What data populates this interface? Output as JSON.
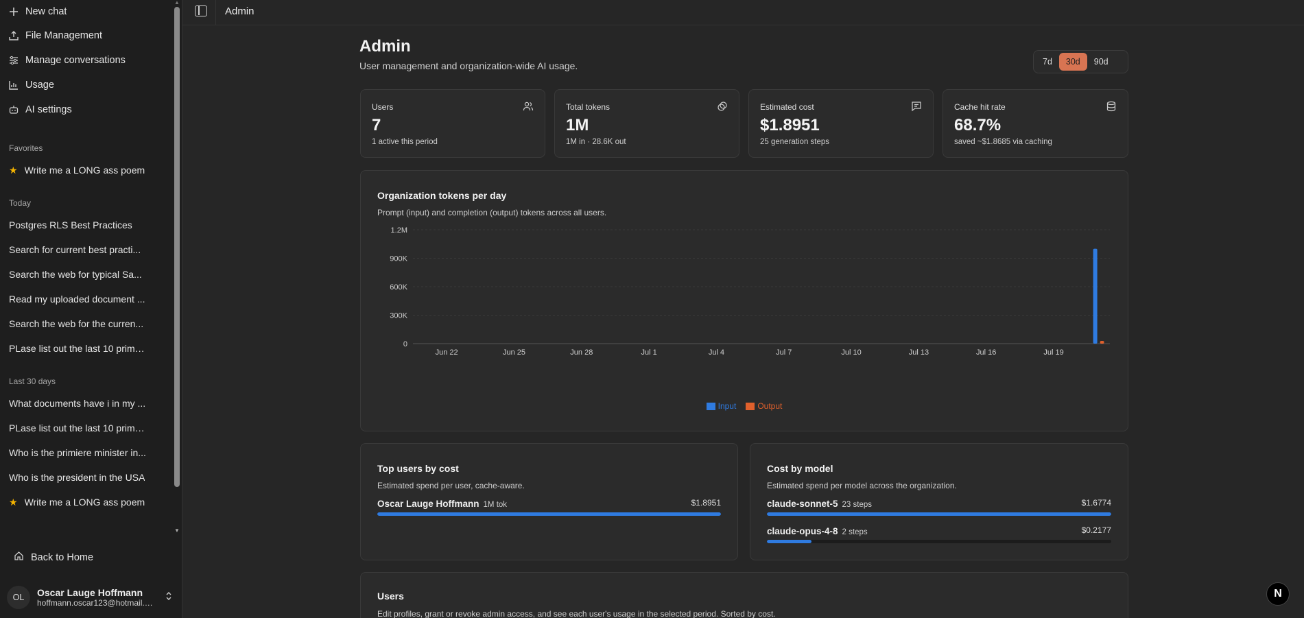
{
  "sidebar": {
    "actions": [
      {
        "label": "New chat",
        "icon": "plus-icon"
      },
      {
        "label": "File Management",
        "icon": "upload-icon"
      },
      {
        "label": "Manage conversations",
        "icon": "sliders-icon"
      },
      {
        "label": "Usage",
        "icon": "bar-chart-icon"
      },
      {
        "label": "AI settings",
        "icon": "bot-icon"
      }
    ],
    "favorites_heading": "Favorites",
    "favorites": [
      {
        "label": "Write me a LONG ass poem"
      }
    ],
    "today_heading": "Today",
    "today": [
      {
        "label": "Postgres RLS Best Practices"
      },
      {
        "label": "Search for current best practi..."
      },
      {
        "label": "Search the web for typical Sa..."
      },
      {
        "label": "Read my uploaded document ..."
      },
      {
        "label": "Search the web for the curren..."
      },
      {
        "label": "PLase list out the last 10 prime..."
      }
    ],
    "last30_heading": "Last 30 days",
    "last30": [
      {
        "label": "What documents have i in my ...",
        "starred": false
      },
      {
        "label": "PLase list out the last 10 prime...",
        "starred": false
      },
      {
        "label": "Who is the primiere minister in...",
        "starred": false
      },
      {
        "label": "Who is the president in the USA",
        "starred": false
      },
      {
        "label": "Write me a LONG ass poem",
        "starred": true
      }
    ],
    "back_home": "Back to Home",
    "user": {
      "initials": "OL",
      "name": "Oscar Lauge Hoffmann",
      "email": "hoffmann.oscar123@hotmail.c..."
    }
  },
  "topbar": {
    "title": "Admin"
  },
  "page": {
    "title": "Admin",
    "subtitle": "User management and organization-wide AI usage.",
    "range_options": [
      "7d",
      "30d",
      "90d"
    ],
    "range_selected": "30d"
  },
  "stats": [
    {
      "label": "Users",
      "value": "7",
      "sub": "1 active this period",
      "icon": "users-icon"
    },
    {
      "label": "Total tokens",
      "value": "1M",
      "sub": "1M in · 28.6K out",
      "icon": "link-icon"
    },
    {
      "label": "Estimated cost",
      "value": "$1.8951",
      "sub": "25 generation steps",
      "icon": "message-square-icon"
    },
    {
      "label": "Cache hit rate",
      "value": "68.7%",
      "sub": "saved ~$1.8685 via caching",
      "icon": "database-icon"
    }
  ],
  "tokens_card": {
    "title": "Organization tokens per day",
    "subtitle": "Prompt (input) and completion (output) tokens across all users."
  },
  "chart_data": {
    "type": "bar",
    "title": "Organization tokens per day",
    "x_ticks": [
      "Jun 22",
      "Jun 25",
      "Jun 28",
      "Jul 1",
      "Jul 4",
      "Jul 7",
      "Jul 10",
      "Jul 13",
      "Jul 16",
      "Jul 19"
    ],
    "y_ticks": [
      "0",
      "300K",
      "600K",
      "900K",
      "1.2M"
    ],
    "ylim": [
      0,
      1200000
    ],
    "grid": true,
    "legend_position": "bottom",
    "x_start": "Jun 21",
    "x_end": "Jul 21",
    "series": [
      {
        "name": "Input",
        "color": "#2f7be0",
        "points": [
          {
            "x": "Jul 21",
            "y": 1000000
          }
        ]
      },
      {
        "name": "Output",
        "color": "#e0602c",
        "points": [
          {
            "x": "Jul 21",
            "y": 28600
          }
        ]
      }
    ]
  },
  "top_users": {
    "title": "Top users by cost",
    "subtitle": "Estimated spend per user, cache-aware.",
    "rows": [
      {
        "name": "Oscar Lauge Hoffmann",
        "meta": "1M tok",
        "amount": "$1.8951",
        "share": 1.0
      }
    ]
  },
  "cost_by_model": {
    "title": "Cost by model",
    "subtitle": "Estimated spend per model across the organization.",
    "rows": [
      {
        "name": "claude-sonnet-5",
        "meta": "23 steps",
        "amount": "$1.6774",
        "share": 1.0
      },
      {
        "name": "claude-opus-4-8",
        "meta": "2 steps",
        "amount": "$0.2177",
        "share": 0.13
      }
    ]
  },
  "users_card": {
    "title": "Users",
    "subtitle": "Edit profiles, grant or revoke admin access, and see each user's usage in the selected period. Sorted by cost."
  },
  "fab": {
    "label": "N"
  }
}
